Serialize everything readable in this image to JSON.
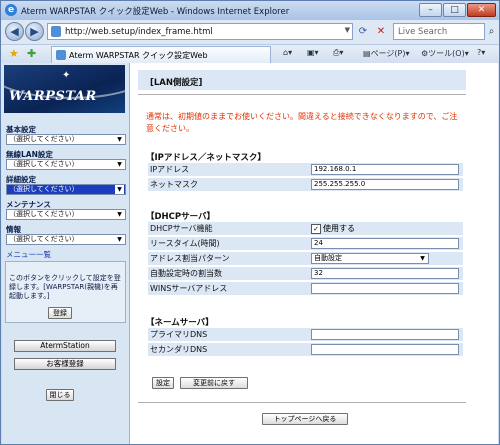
{
  "window": {
    "title": "Aterm WARPSTAR クイック設定Web - Windows Internet Explorer",
    "minimize": "–",
    "maximize": "□",
    "close": "✕"
  },
  "browser": {
    "url": "http://web.setup/index_frame.html",
    "search_placeholder": "Live Search",
    "tab_title": "Aterm WARPSTAR クイック設定Web",
    "page_menu": "ページ(P)",
    "tools_menu": "ツール(O)"
  },
  "sidebar": {
    "logo_text": "WARPSTAR",
    "groups": [
      {
        "label": "基本設定",
        "value": "（選択してください）",
        "active": false
      },
      {
        "label": "無線LAN設定",
        "value": "（選択してください）",
        "active": false
      },
      {
        "label": "詳細設定",
        "value": "（選択してください）",
        "active": true
      },
      {
        "label": "メンテナンス",
        "value": "（選択してください）",
        "active": false
      },
      {
        "label": "情報",
        "value": "（選択してください）",
        "active": false
      }
    ],
    "menu_list_link": "メニュー一覧",
    "note": "このボタンをクリックして設定を登録します。[WARPSTAR(親機)を再起動します。]",
    "register_button": "登録",
    "aterm_station_button": "AtermStation",
    "customer_register_button": "お客様登録",
    "close_button": "閉じる"
  },
  "main": {
    "header": "[LAN側設定]",
    "warning": "通常は、初期値のままでお使いください。間違えると接続できなくなりますので、ご注意ください。",
    "ip_section": {
      "title": "【IPアドレス／ネットマスク】",
      "rows": [
        {
          "label": "IPアドレス",
          "value": "192.168.0.1"
        },
        {
          "label": "ネットマスク",
          "value": "255.255.255.0"
        }
      ]
    },
    "dhcp_section": {
      "title": "【DHCPサーバ】",
      "function_label": "DHCPサーバ機能",
      "function_check": "✓",
      "function_value": "使用する",
      "lease_label": "リースタイム(時間)",
      "lease_value": "24",
      "pattern_label": "アドレス割当パターン",
      "pattern_value": "自動設定",
      "count_label": "自動設定時の割当数",
      "count_value": "32",
      "wins_label": "WINSサーバアドレス",
      "wins_value": ""
    },
    "name_section": {
      "title": "【ネームサーバ】",
      "rows": [
        {
          "label": "プライマリDNS",
          "value": ""
        },
        {
          "label": "セカンダリDNS",
          "value": ""
        }
      ]
    },
    "set_button": "設定",
    "revert_button": "変更前に戻す",
    "top_button": "トップページへ戻る"
  }
}
